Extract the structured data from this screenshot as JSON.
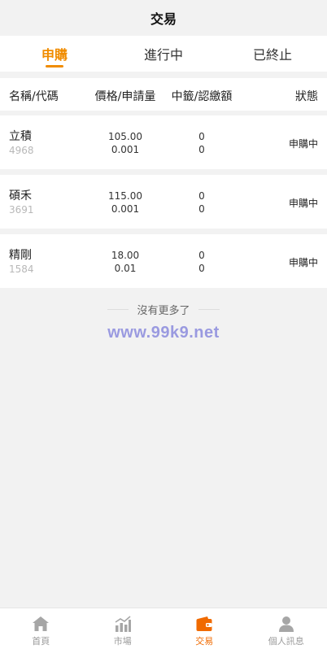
{
  "header": {
    "title": "交易"
  },
  "tabs": [
    {
      "label": "申購",
      "active": true
    },
    {
      "label": "進行中",
      "active": false
    },
    {
      "label": "已終止",
      "active": false
    }
  ],
  "columns": {
    "name": "名稱/代碼",
    "price": "價格/申請量",
    "win": "中籤/認繳額",
    "state": "狀態"
  },
  "rows": [
    {
      "name": "立積",
      "code": "4968",
      "price": "105.00",
      "qty": "0.001",
      "win": "0",
      "amount": "0",
      "state": "申購中"
    },
    {
      "name": "碩禾",
      "code": "3691",
      "price": "115.00",
      "qty": "0.001",
      "win": "0",
      "amount": "0",
      "state": "申購中"
    },
    {
      "name": "精剛",
      "code": "1584",
      "price": "18.00",
      "qty": "0.01",
      "win": "0",
      "amount": "0",
      "state": "申購中"
    }
  ],
  "no_more": "沒有更多了",
  "watermark": "www.99k9.net",
  "tabbar": [
    {
      "label": "首頁",
      "icon": "home-icon",
      "active": false
    },
    {
      "label": "市場",
      "icon": "chart-icon",
      "active": false
    },
    {
      "label": "交易",
      "icon": "wallet-icon",
      "active": true
    },
    {
      "label": "個人訊息",
      "icon": "user-icon",
      "active": false
    }
  ],
  "colors": {
    "accent": "#f08c00",
    "tabbar_active": "#f06a00",
    "watermark": "#9a9ae0"
  }
}
